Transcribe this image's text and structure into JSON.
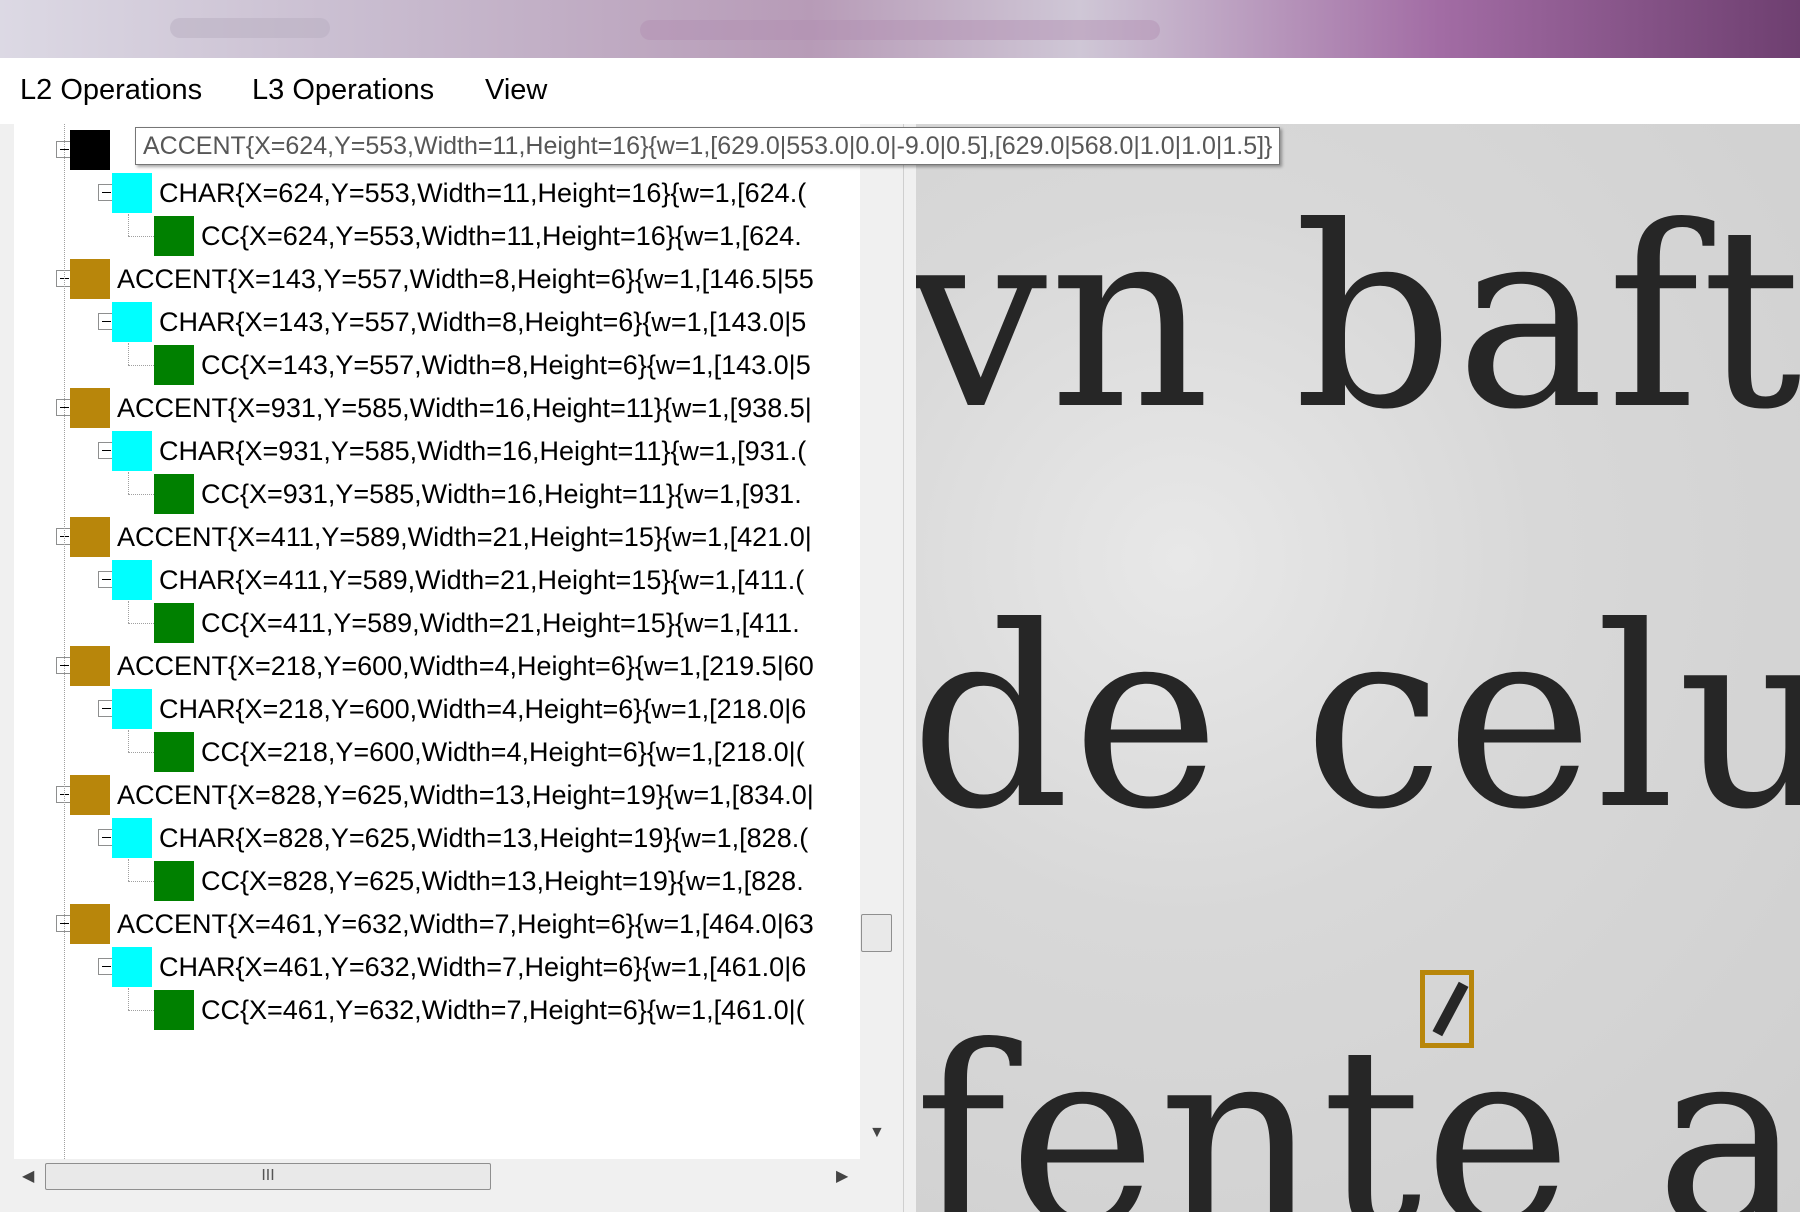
{
  "menu": {
    "items": [
      "L2 Operations",
      "L3 Operations",
      "View"
    ]
  },
  "tooltip": {
    "text": "ACCENT{X=624,Y=553,Width=11,Height=16}{w=1,[629.0|553.0|0.0|-9.0|0.5],[629.0|568.0|1.0|1.0|1.5]}"
  },
  "tree": {
    "rows": [
      {
        "level": 0,
        "kind": "accent-selected",
        "color": "#000000",
        "label": ""
      },
      {
        "level": 1,
        "kind": "char",
        "color": "#00ffff",
        "label": "CHAR{X=624,Y=553,Width=11,Height=16}{w=1,[624.("
      },
      {
        "level": 2,
        "kind": "cc",
        "color": "#008000",
        "label": "CC{X=624,Y=553,Width=11,Height=16}{w=1,[624."
      },
      {
        "level": 0,
        "kind": "accent",
        "color": "#b8860b",
        "label": "ACCENT{X=143,Y=557,Width=8,Height=6}{w=1,[146.5|55"
      },
      {
        "level": 1,
        "kind": "char",
        "color": "#00ffff",
        "label": "CHAR{X=143,Y=557,Width=8,Height=6}{w=1,[143.0|5"
      },
      {
        "level": 2,
        "kind": "cc",
        "color": "#008000",
        "label": "CC{X=143,Y=557,Width=8,Height=6}{w=1,[143.0|5"
      },
      {
        "level": 0,
        "kind": "accent",
        "color": "#b8860b",
        "label": "ACCENT{X=931,Y=585,Width=16,Height=11}{w=1,[938.5|"
      },
      {
        "level": 1,
        "kind": "char",
        "color": "#00ffff",
        "label": "CHAR{X=931,Y=585,Width=16,Height=11}{w=1,[931.("
      },
      {
        "level": 2,
        "kind": "cc",
        "color": "#008000",
        "label": "CC{X=931,Y=585,Width=16,Height=11}{w=1,[931."
      },
      {
        "level": 0,
        "kind": "accent",
        "color": "#b8860b",
        "label": "ACCENT{X=411,Y=589,Width=21,Height=15}{w=1,[421.0|"
      },
      {
        "level": 1,
        "kind": "char",
        "color": "#00ffff",
        "label": "CHAR{X=411,Y=589,Width=21,Height=15}{w=1,[411.("
      },
      {
        "level": 2,
        "kind": "cc",
        "color": "#008000",
        "label": "CC{X=411,Y=589,Width=21,Height=15}{w=1,[411."
      },
      {
        "level": 0,
        "kind": "accent",
        "color": "#b8860b",
        "label": "ACCENT{X=218,Y=600,Width=4,Height=6}{w=1,[219.5|60"
      },
      {
        "level": 1,
        "kind": "char",
        "color": "#00ffff",
        "label": "CHAR{X=218,Y=600,Width=4,Height=6}{w=1,[218.0|6"
      },
      {
        "level": 2,
        "kind": "cc",
        "color": "#008000",
        "label": "CC{X=218,Y=600,Width=4,Height=6}{w=1,[218.0|("
      },
      {
        "level": 0,
        "kind": "accent",
        "color": "#b8860b",
        "label": "ACCENT{X=828,Y=625,Width=13,Height=19}{w=1,[834.0|"
      },
      {
        "level": 1,
        "kind": "char",
        "color": "#00ffff",
        "label": "CHAR{X=828,Y=625,Width=13,Height=19}{w=1,[828.("
      },
      {
        "level": 2,
        "kind": "cc",
        "color": "#008000",
        "label": "CC{X=828,Y=625,Width=13,Height=19}{w=1,[828."
      },
      {
        "level": 0,
        "kind": "accent",
        "color": "#b8860b",
        "label": "ACCENT{X=461,Y=632,Width=7,Height=6}{w=1,[464.0|63"
      },
      {
        "level": 1,
        "kind": "char",
        "color": "#00ffff",
        "label": "CHAR{X=461,Y=632,Width=7,Height=6}{w=1,[461.0|6"
      },
      {
        "level": 2,
        "kind": "cc",
        "color": "#008000",
        "label": "CC{X=461,Y=632,Width=7,Height=6}{w=1,[461.0|("
      }
    ]
  },
  "scrollbars": {
    "h_thumb_glyph": "III",
    "left_arrow": "◀",
    "right_arrow": "▶",
    "down_arrow": "▼"
  },
  "document": {
    "lines": [
      "vn bafto",
      "de celuy",
      "fente au"
    ],
    "selection_color": "#b8860b"
  }
}
